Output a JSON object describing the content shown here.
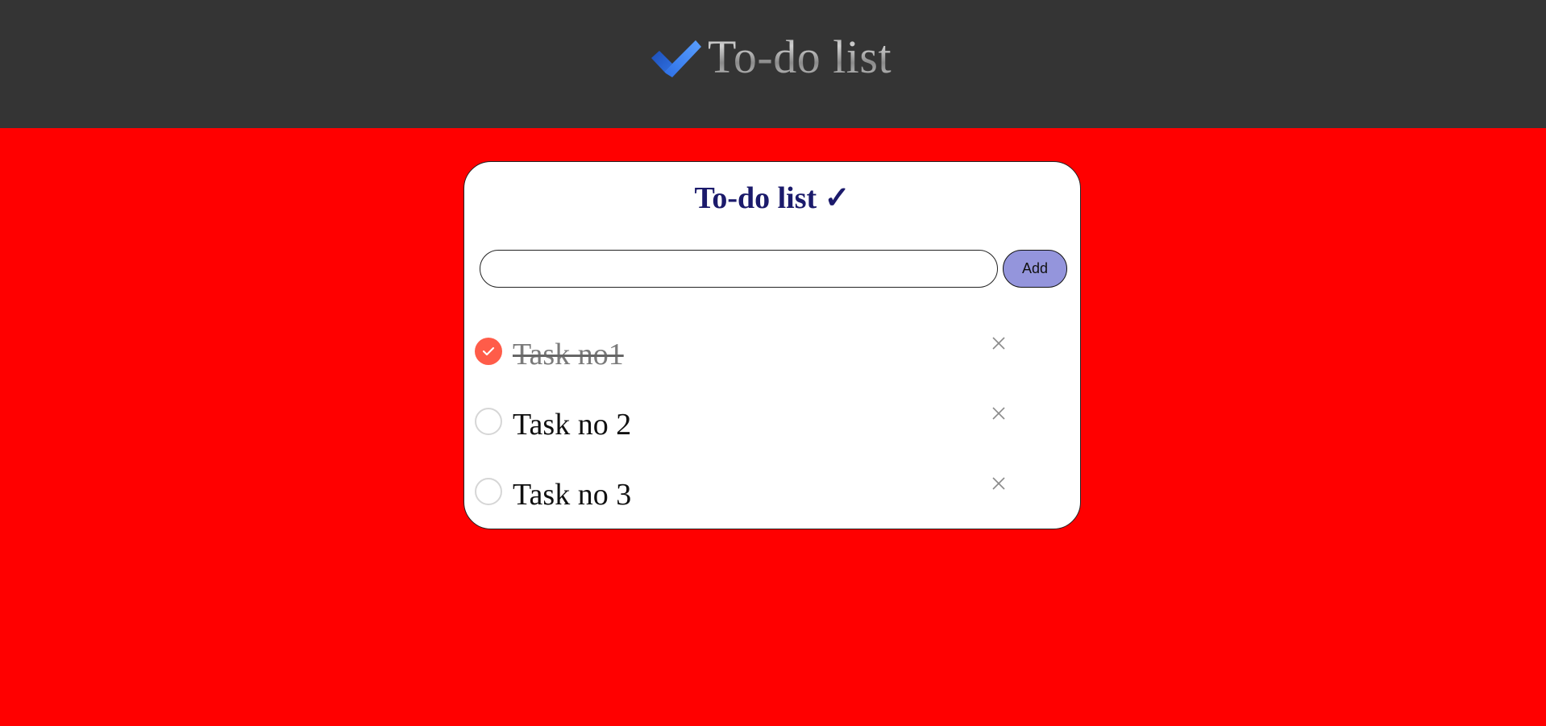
{
  "header": {
    "title": "To-do list",
    "icon": "double-check-icon",
    "background": "#343434"
  },
  "page": {
    "background": "#ff0000"
  },
  "card": {
    "title": "To-do list ✓",
    "title_color": "#1b1a6b",
    "input": {
      "value": "",
      "placeholder": ""
    },
    "add_label": "Add",
    "add_color": "#9495dc"
  },
  "tasks": [
    {
      "label": "Task no1",
      "done": true
    },
    {
      "label": "Task no 2",
      "done": false
    },
    {
      "label": "Task no 3",
      "done": false
    }
  ],
  "colors": {
    "checked": "#ff5c49",
    "unchecked_border": "#d6d6d6"
  }
}
